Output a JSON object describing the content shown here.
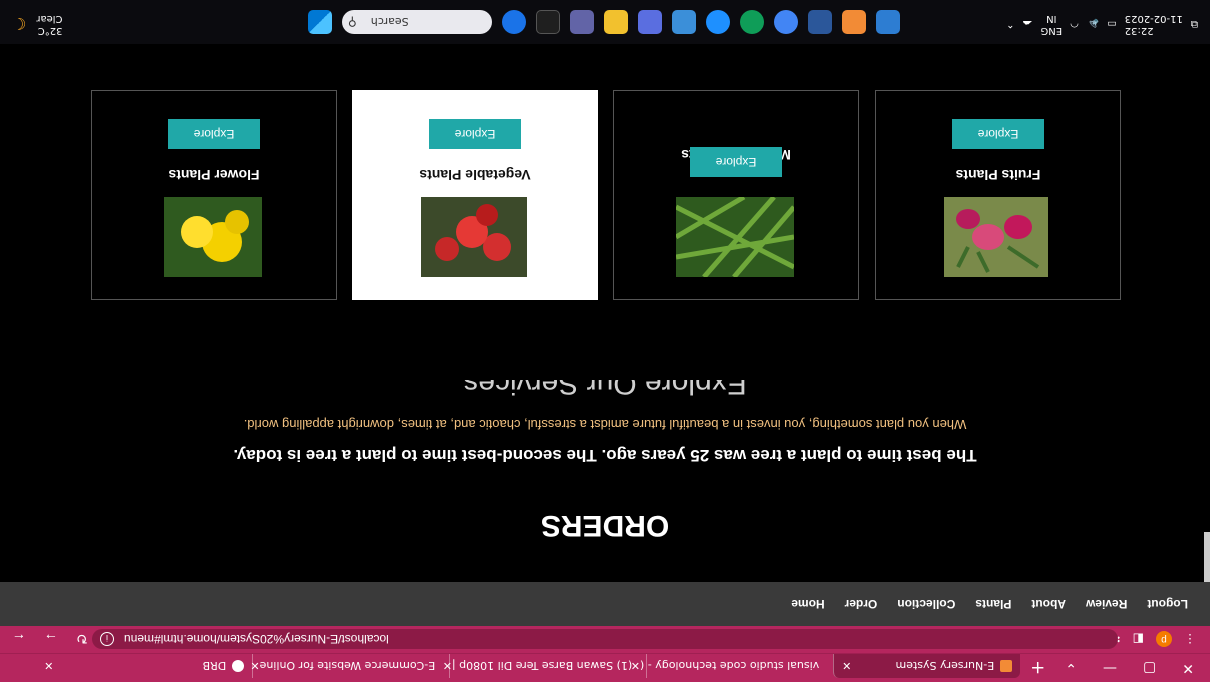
{
  "browser": {
    "tabs": [
      {
        "label": "E-Nursery System",
        "icon_color": "#f28b36"
      },
      {
        "label": "visual studio code technology - (",
        "icon_color": "#4285f4"
      },
      {
        "label": "(1) Sawan Barse Tere Dil 1080p |",
        "icon_color": "#ff0000"
      },
      {
        "label": "E-Commerce Website for Online",
        "icon_color": "#e53935"
      },
      {
        "label": "DRB",
        "icon_color": "#ffffff"
      }
    ],
    "new_tab": "+",
    "url": "localhost/E-Nursery%20System/home.html#menu",
    "profile_initial": "p"
  },
  "site_nav": {
    "items": [
      "Home",
      "Order",
      "Collection",
      "Plants",
      "About",
      "Review",
      "Logout"
    ]
  },
  "orders": {
    "title": "ORDERS",
    "quote1": "The best time to plant a tree was 25 years ago. The second-best time to plant a tree is today.",
    "quote2": "When you plant something, you invest in a beautiful future amidst a stressful, chaotic and, at times, downright appalling world.",
    "services_title": "Explore Our Services"
  },
  "cards": [
    {
      "title": "Flower Plants",
      "button": "Explore"
    },
    {
      "title": "Vegetable Plants",
      "button": "Explore"
    },
    {
      "title": "Medicinal Plants",
      "button": "Explore"
    },
    {
      "title": "Fruits Plants",
      "button": "Explore"
    }
  ],
  "taskbar": {
    "weather_temp": "32°C",
    "weather_text": "Clear",
    "search_placeholder": "Search",
    "lang_top": "IN",
    "lang_bottom": "ENG",
    "time": "22:32",
    "date": "11-02-2023"
  },
  "colors": {
    "accent": "#20a8a8",
    "browser": "#b5265e",
    "nav": "#3a3a3a"
  }
}
